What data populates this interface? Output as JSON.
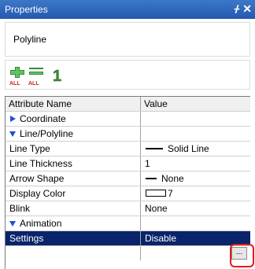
{
  "panel": {
    "title": "Properties",
    "pin_glyph": "ᚋ",
    "close_glyph": "✕",
    "object_name": "Polyline"
  },
  "toolbar": {
    "expand_all_icon": "plus-all-icon",
    "collapse_all_icon": "minus-all-icon",
    "one_icon": "one-icon",
    "one_glyph": "1"
  },
  "grid": {
    "header": {
      "name": "Attribute Name",
      "value": "Value"
    },
    "rows": [
      {
        "kind": "category",
        "expanded": false,
        "name": "Coordinate",
        "value": ""
      },
      {
        "kind": "category",
        "expanded": true,
        "name": "Line/Polyline",
        "value": ""
      },
      {
        "kind": "item",
        "name": "Line Type",
        "value": "Solid Line"
      },
      {
        "kind": "item",
        "name": "Line Thickness",
        "value": "1"
      },
      {
        "kind": "item",
        "name": "Arrow Shape",
        "value": "None"
      },
      {
        "kind": "item",
        "name": "Display Color",
        "value": "7"
      },
      {
        "kind": "item",
        "name": "Blink",
        "value": "None"
      },
      {
        "kind": "category",
        "expanded": true,
        "name": "Animation",
        "value": ""
      },
      {
        "kind": "item",
        "selected": true,
        "name": "Settings",
        "value": "Disable"
      }
    ]
  },
  "ellipsis_label": "...",
  "colors": {
    "titlebar": "#2c64b8",
    "selection": "#0a246a",
    "expand_arrow": "#1f4fd6",
    "highlight": "#e21b1b"
  }
}
